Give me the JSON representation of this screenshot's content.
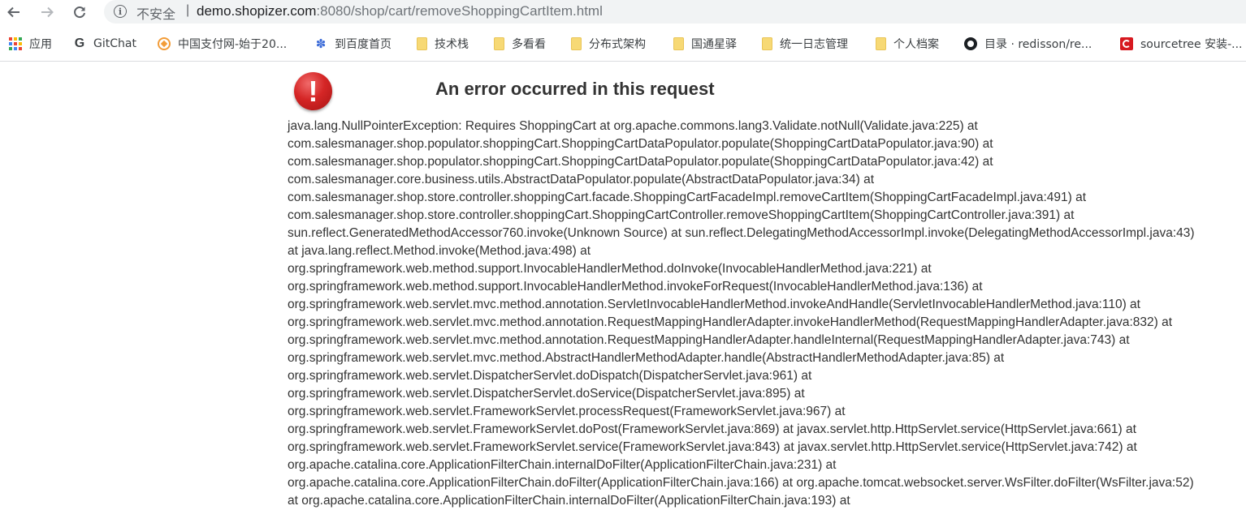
{
  "browser": {
    "security_label": "不安全",
    "separator": "|",
    "url_host": "demo.shopizer.com",
    "url_rest": ":8080/shop/cart/removeShoppingCartItem.html"
  },
  "bookmarks": [
    {
      "label": "应用",
      "icon": "apps-grid-icon"
    },
    {
      "label": "GitChat",
      "icon": "g-icon"
    },
    {
      "label": "中国支付网-始于20...",
      "icon": "payment-site-icon"
    },
    {
      "label": "到百度首页",
      "icon": "baidu-paw-icon"
    },
    {
      "label": "技术栈",
      "icon": "folder-icon"
    },
    {
      "label": "多看看",
      "icon": "folder-icon"
    },
    {
      "label": "分布式架构",
      "icon": "folder-icon"
    },
    {
      "label": "国通星驿",
      "icon": "folder-icon"
    },
    {
      "label": "统一日志管理",
      "icon": "folder-icon"
    },
    {
      "label": "个人档案",
      "icon": "folder-icon"
    },
    {
      "label": "目录 · redisson/re...",
      "icon": "github-icon"
    },
    {
      "label": "sourcetree 安装-...",
      "icon": "sourcetree-icon"
    }
  ],
  "error": {
    "icon": "exclamation-icon",
    "icon_glyph": "!",
    "title": "An error occurred in this request",
    "lines": [
      "java.lang.NullPointerException: Requires ShoppingCart at org.apache.commons.lang3.Validate.notNull(Validate.java:225) at",
      "com.salesmanager.shop.populator.shoppingCart.ShoppingCartDataPopulator.populate(ShoppingCartDataPopulator.java:90) at",
      "com.salesmanager.shop.populator.shoppingCart.ShoppingCartDataPopulator.populate(ShoppingCartDataPopulator.java:42) at",
      "com.salesmanager.core.business.utils.AbstractDataPopulator.populate(AbstractDataPopulator.java:34) at",
      "com.salesmanager.shop.store.controller.shoppingCart.facade.ShoppingCartFacadeImpl.removeCartItem(ShoppingCartFacadeImpl.java:491) at",
      "com.salesmanager.shop.store.controller.shoppingCart.ShoppingCartController.removeShoppingCartItem(ShoppingCartController.java:391) at",
      "sun.reflect.GeneratedMethodAccessor760.invoke(Unknown Source) at sun.reflect.DelegatingMethodAccessorImpl.invoke(DelegatingMethodAccessorImpl.java:43)",
      "at java.lang.reflect.Method.invoke(Method.java:498) at",
      "org.springframework.web.method.support.InvocableHandlerMethod.doInvoke(InvocableHandlerMethod.java:221) at",
      "org.springframework.web.method.support.InvocableHandlerMethod.invokeForRequest(InvocableHandlerMethod.java:136) at",
      "org.springframework.web.servlet.mvc.method.annotation.ServletInvocableHandlerMethod.invokeAndHandle(ServletInvocableHandlerMethod.java:110) at",
      "org.springframework.web.servlet.mvc.method.annotation.RequestMappingHandlerAdapter.invokeHandlerMethod(RequestMappingHandlerAdapter.java:832) at",
      "org.springframework.web.servlet.mvc.method.annotation.RequestMappingHandlerAdapter.handleInternal(RequestMappingHandlerAdapter.java:743) at",
      "org.springframework.web.servlet.mvc.method.AbstractHandlerMethodAdapter.handle(AbstractHandlerMethodAdapter.java:85) at",
      "org.springframework.web.servlet.DispatcherServlet.doDispatch(DispatcherServlet.java:961) at",
      "org.springframework.web.servlet.DispatcherServlet.doService(DispatcherServlet.java:895) at",
      "org.springframework.web.servlet.FrameworkServlet.processRequest(FrameworkServlet.java:967) at",
      "org.springframework.web.servlet.FrameworkServlet.doPost(FrameworkServlet.java:869) at javax.servlet.http.HttpServlet.service(HttpServlet.java:661) at",
      "org.springframework.web.servlet.FrameworkServlet.service(FrameworkServlet.java:843) at javax.servlet.http.HttpServlet.service(HttpServlet.java:742) at",
      "org.apache.catalina.core.ApplicationFilterChain.internalDoFilter(ApplicationFilterChain.java:231) at",
      "org.apache.catalina.core.ApplicationFilterChain.doFilter(ApplicationFilterChain.java:166) at org.apache.tomcat.websocket.server.WsFilter.doFilter(WsFilter.java:52)",
      "at org.apache.catalina.core.ApplicationFilterChain.internalDoFilter(ApplicationFilterChain.java:193) at"
    ]
  },
  "colors": {
    "accent_error": "#d52626",
    "text": "#333333",
    "bookmark_folder": "#f7d975"
  }
}
